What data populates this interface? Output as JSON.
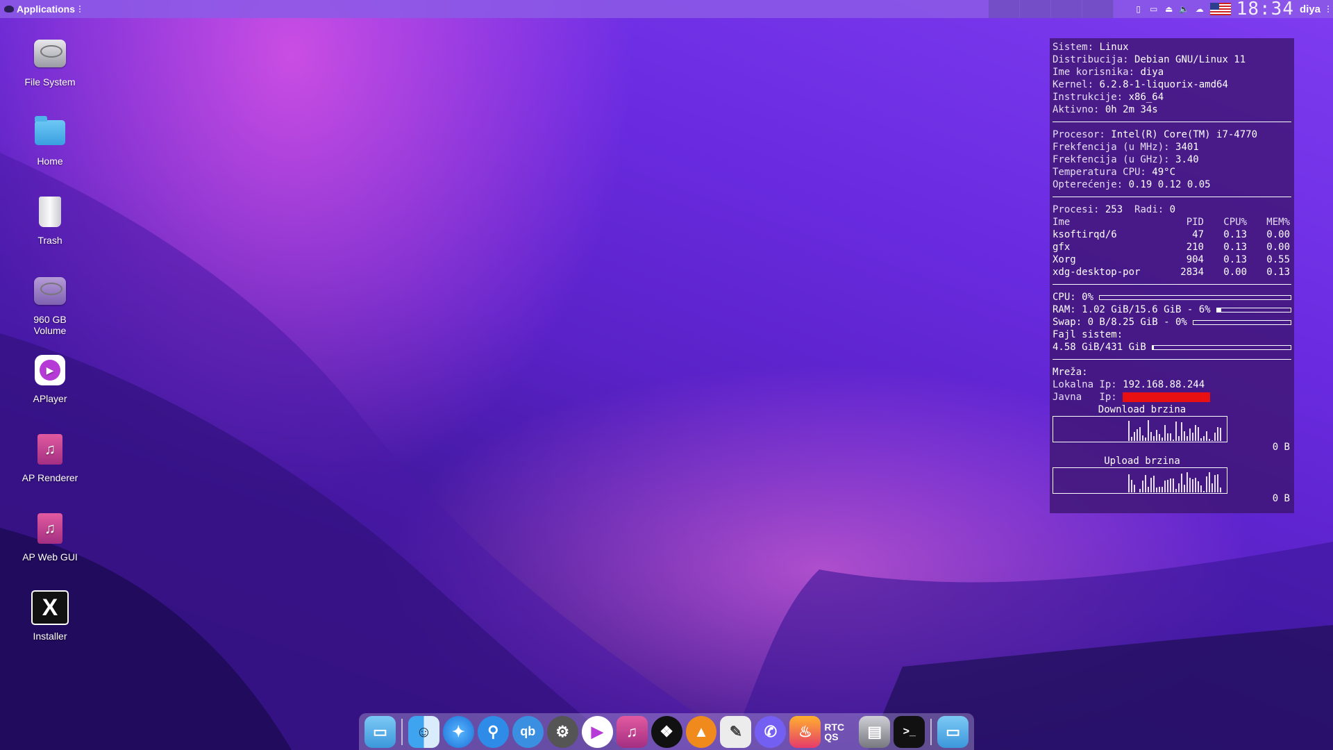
{
  "topbar": {
    "applications_label": "Applications",
    "clock": "18:34",
    "user": "diya"
  },
  "desktop": {
    "icons": [
      {
        "label": "File System",
        "icon": "drive-icon"
      },
      {
        "label": "Home",
        "icon": "home-folder-icon"
      },
      {
        "label": "Trash",
        "icon": "trash-icon"
      },
      {
        "label": "960 GB Volume",
        "icon": "volume-icon"
      },
      {
        "label": "APlayer",
        "icon": "aplayer-icon"
      },
      {
        "label": "AP Renderer",
        "icon": "music-file-icon"
      },
      {
        "label": "AP Web GUI",
        "icon": "music-file-icon"
      },
      {
        "label": "Installer",
        "icon": "installer-x-icon"
      }
    ]
  },
  "conky": {
    "system": [
      {
        "label": "Sistem:",
        "value": "Linux"
      },
      {
        "label": "Distribucija:",
        "value": "Debian GNU/Linux 11"
      },
      {
        "label": "Ime korisnika:",
        "value": "diya"
      },
      {
        "label": "Kernel:",
        "value": "6.2.8-1-liquorix-amd64"
      },
      {
        "label": "Instrukcije:",
        "value": "x86_64"
      },
      {
        "label": "Aktivno:",
        "value": "0h 2m 34s"
      }
    ],
    "cpu_info": [
      {
        "label": "Procesor:",
        "value": "Intel(R) Core(TM) i7-4770"
      },
      {
        "label": "Frekfencija (u MHz):",
        "value": "3401"
      },
      {
        "label": "Frekfencija (u GHz):",
        "value": "3.40"
      },
      {
        "label": "Temperatura CPU:",
        "value": "49°C"
      },
      {
        "label": "Opterećenje:",
        "value": "0.19 0.12 0.05"
      }
    ],
    "procesi_label": "Procesi:",
    "procesi_value": "253",
    "radi_label": "Radi:",
    "radi_value": "0",
    "process_headers": [
      "Ime",
      "PID",
      "CPU%",
      "MEM%"
    ],
    "processes": [
      [
        "ksoftirqd/6",
        "47",
        "0.13",
        "0.00"
      ],
      [
        "gfx",
        "210",
        "0.13",
        "0.00"
      ],
      [
        "Xorg",
        "904",
        "0.13",
        "0.55"
      ],
      [
        "xdg-desktop-por",
        "2834",
        "0.00",
        "0.13"
      ]
    ],
    "cpu_line": "CPU: 0%",
    "cpu_fraction": 0.0,
    "ram_line": "RAM: 1.02 GiB/15.6 GiB - 6%",
    "ram_fraction": 0.06,
    "swap_line": "Swap: 0 B/8.25 GiB - 0%",
    "swap_fraction": 0.0,
    "fs_label": "Fajl sistem:",
    "fs_line": "4.58 GiB/431 GiB",
    "fs_fraction": 0.01,
    "net_label": "Mreža:",
    "local_ip_label": "Lokalna Ip:",
    "local_ip": "192.168.88.244",
    "public_ip_label": "Javna   Ip:",
    "download_title": "Download brzina",
    "download_value": "0 B",
    "upload_title": "Upload brzina",
    "upload_value": "0 B"
  },
  "dock": {
    "apps": [
      "folder-icon",
      "finder-icon",
      "safari-icon",
      "search-icon",
      "qbittorrent-icon",
      "settings-gear-icon",
      "aplayer-icon",
      "music-file-icon",
      "tidal-icon",
      "vlc-icon",
      "text-editor-icon",
      "viber-icon",
      "flame-app-icon",
      "rtc-qs-icon",
      "drive-icon",
      "terminal-icon",
      "folder-icon"
    ],
    "rtc_label": "RTC QS"
  },
  "colors": {
    "accent": "#8c5ae6",
    "ip_mask": "#e81010"
  }
}
